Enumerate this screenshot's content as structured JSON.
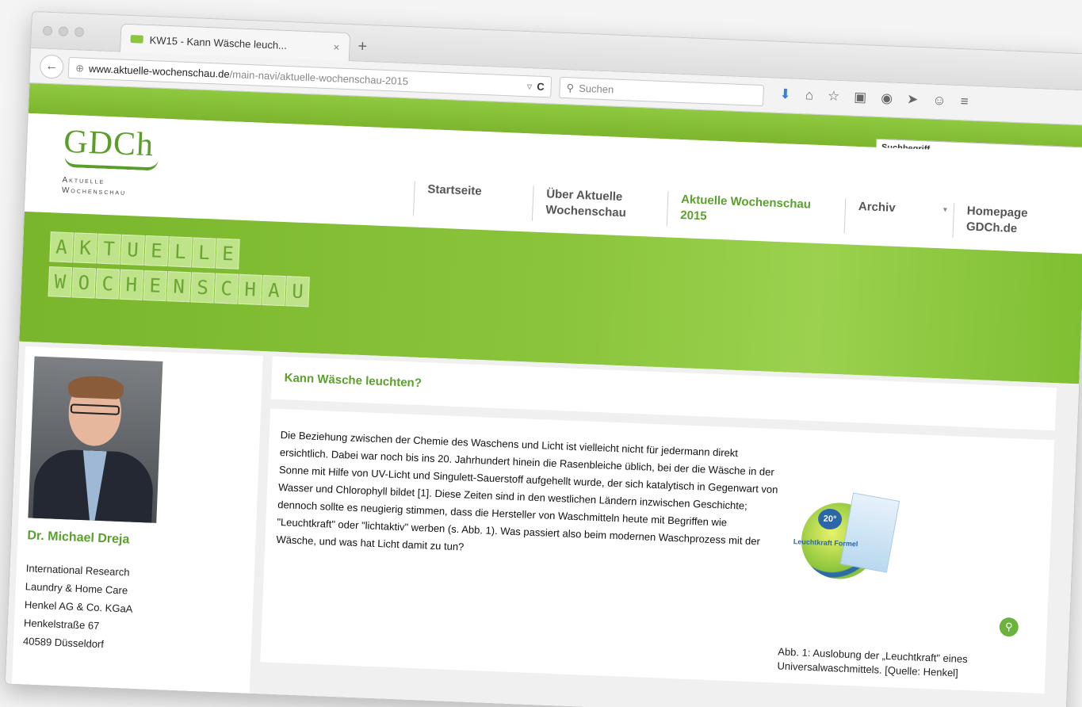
{
  "browser": {
    "tab_title": "KW15 - Kann Wäsche leuch...",
    "tab_close": "×",
    "new_tab": "+",
    "url_host": "www.aktuelle-wochenschau.de",
    "url_path": "/main-navi/aktuelle-wochenschau-2015",
    "url_dropdown": "▿",
    "reload": "C",
    "search_placeholder": "Suchen",
    "toolbar_icons": [
      "download-icon",
      "home-icon",
      "bookmark-star-icon",
      "clipboard-icon",
      "addon-icon",
      "send-icon",
      "chat-icon",
      "menu-icon"
    ]
  },
  "site": {
    "search_placeholder": "Suchbegriff",
    "logo_text": "GDCh",
    "logo_sub1": "Aktuelle",
    "logo_sub2": "Wochenschau",
    "nav": [
      {
        "label": "Startseite"
      },
      {
        "label": "Über Aktuelle Wochenschau"
      },
      {
        "label": "Aktuelle Wochenschau 2015",
        "active": true
      },
      {
        "label": "Archiv"
      },
      {
        "label": "Homepage GDCh.de"
      }
    ],
    "banner_row1": [
      "A",
      "K",
      "T",
      "U",
      "E",
      "L",
      "L",
      "E"
    ],
    "banner_row2": [
      "W",
      "O",
      "C",
      "H",
      "E",
      "N",
      "S",
      "C",
      "H",
      "A",
      "U"
    ]
  },
  "sidebar": {
    "author_name": "Dr. Michael Dreja",
    "lines": [
      "International Research",
      "Laundry & Home Care",
      "Henkel AG & Co. KGaA",
      "Henkelstraße 67",
      "40589 Düsseldorf"
    ]
  },
  "article": {
    "title": "Kann Wäsche leuchten?",
    "body": "Die Beziehung zwischen der Chemie des Waschens und Licht ist vielleicht nicht für jedermann direkt ersichtlich. Dabei war noch bis ins 20. Jahrhundert hinein die Rasenbleiche üblich, bei der die Wäsche in der Sonne mit Hilfe von UV-Licht und Singulett-Sauerstoff aufgehellt wurde, der sich katalytisch in Gegenwart von Wasser und Chlorophyll bildet [1]. Diese Zeiten sind in den westlichen Ländern inzwischen Geschichte; dennoch sollte es neugierig stimmen, dass die Hersteller von Waschmitteln heute mit Begriffen wie \"Leuchtkraft\" oder \"lichtaktiv\" werben (s. Abb. 1). Was passiert also beim modernen Waschprozess mit der Wäsche, und was hat Licht damit zu tun?",
    "figure_badge": "20°",
    "figure_label": "Leuchtkraft Formel",
    "caption": "Abb. 1: Auslobung der „Leuchtkraft\" eines Universalwaschmittels. [Quelle: Henkel]"
  }
}
